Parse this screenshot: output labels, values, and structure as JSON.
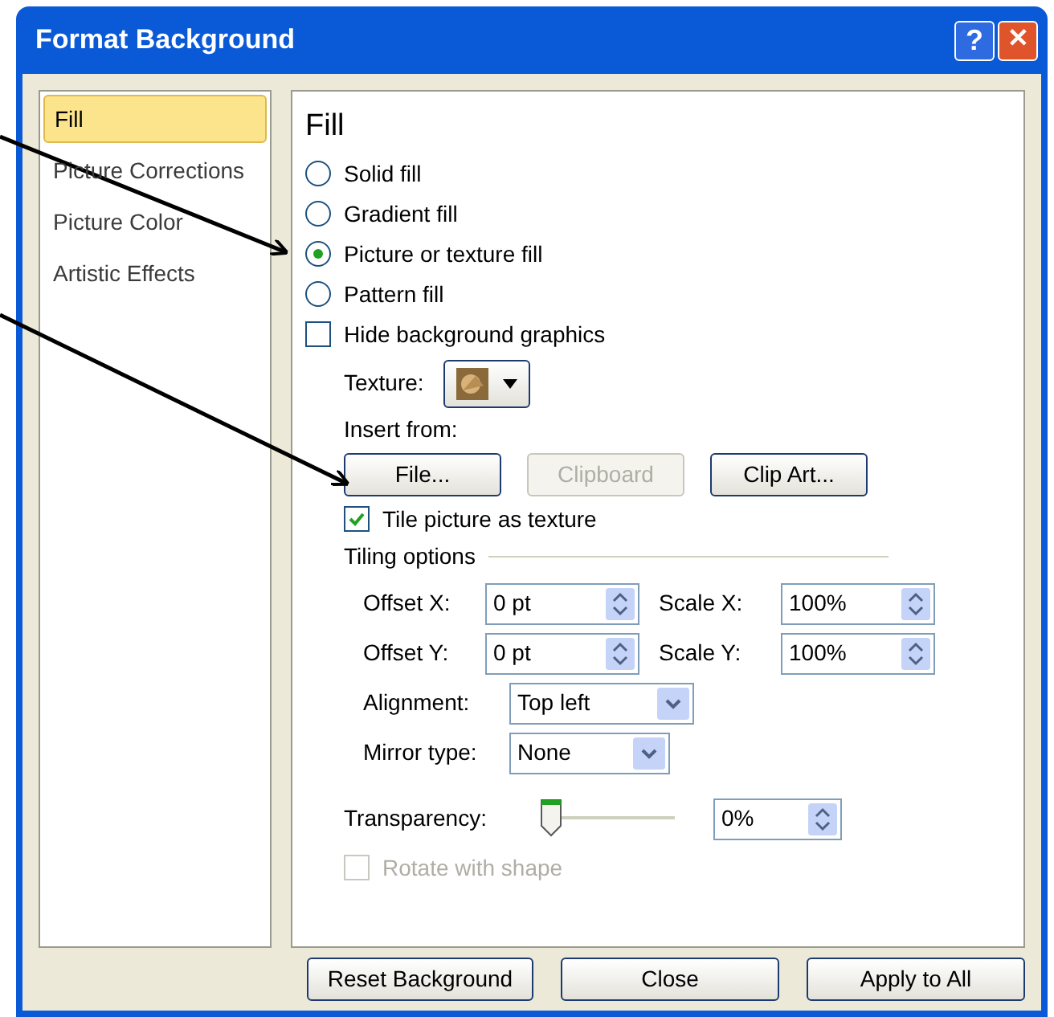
{
  "window": {
    "title": "Format Background",
    "help": "?",
    "close": "✕"
  },
  "sidebar": {
    "items": [
      {
        "label": "Fill",
        "selected": true
      },
      {
        "label": "Picture Corrections",
        "selected": false
      },
      {
        "label": "Picture Color",
        "selected": false
      },
      {
        "label": "Artistic Effects",
        "selected": false
      }
    ]
  },
  "panel": {
    "heading": "Fill",
    "fill_options": [
      {
        "label": "Solid fill",
        "selected": false
      },
      {
        "label": "Gradient fill",
        "selected": false
      },
      {
        "label": "Picture or texture fill",
        "selected": true
      },
      {
        "label": "Pattern fill",
        "selected": false
      }
    ],
    "hide_background": {
      "label": "Hide background graphics",
      "checked": false
    },
    "texture": {
      "label": "Texture:"
    },
    "insert_from": {
      "label": "Insert from:",
      "buttons": [
        {
          "label": "File...",
          "disabled": false
        },
        {
          "label": "Clipboard",
          "disabled": true
        },
        {
          "label": "Clip Art...",
          "disabled": false
        }
      ]
    },
    "tile": {
      "label": "Tile picture as texture",
      "checked": true
    },
    "tiling_options": {
      "title": "Tiling options",
      "spinners": [
        {
          "label": "Offset X:",
          "value": "0 pt"
        },
        {
          "label": "Scale X:",
          "value": "100%"
        },
        {
          "label": "Offset Y:",
          "value": "0 pt"
        },
        {
          "label": "Scale Y:",
          "value": "100%"
        }
      ],
      "alignment": {
        "label": "Alignment:",
        "value": "Top left"
      },
      "mirror": {
        "label": "Mirror type:",
        "value": "None"
      }
    },
    "transparency": {
      "label": "Transparency:",
      "level": 0,
      "value": "0%"
    },
    "rotate": {
      "label": "Rotate with shape",
      "checked": false,
      "disabled": true
    }
  },
  "buttons": [
    "Reset Background",
    "Close",
    "Apply to All"
  ]
}
